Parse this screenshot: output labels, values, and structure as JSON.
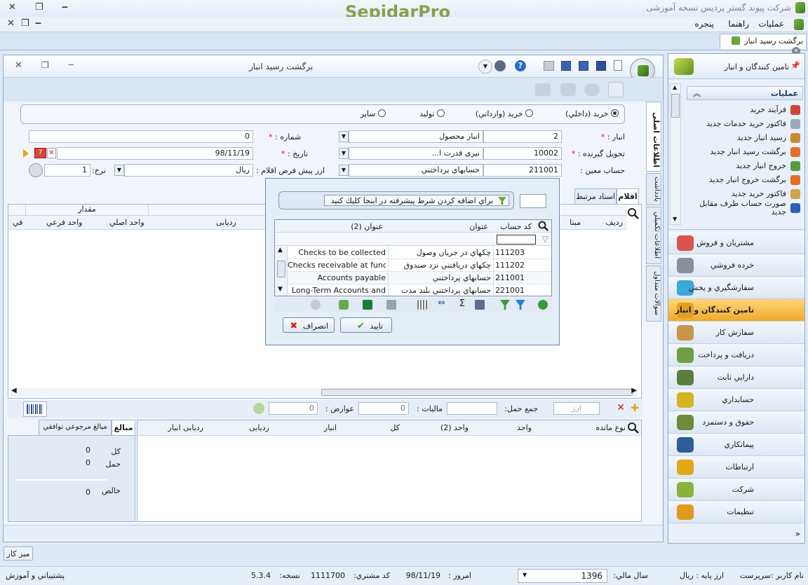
{
  "app": {
    "title": "شرکت پیوند گستر پردیس نسخه آموزشی",
    "logo": "SepidarPro",
    "menu": [
      "عملیات",
      "راهنما",
      "پنجره"
    ]
  },
  "doc_tab": {
    "label": "برگشت رسید انبار"
  },
  "doc": {
    "title": "برگشت رسید انبار",
    "side_tabs": [
      "اطلاعات اصلی",
      "يادداشت",
      "اطلاعات تكميلي",
      "سوالات متداول"
    ],
    "type_options": [
      "خريد (داخلي)",
      "خريد (وارداتي)",
      "توليد",
      "ساير"
    ],
    "type_selected": 0,
    "fields": {
      "anbar_label": "انبار :",
      "anbar_code": "2",
      "anbar_name": "انبار محصول",
      "tahvil_label": "تحويل گيرنده :",
      "tahvil_code": "10002",
      "tahvil_name": "نيري قدرت ا...",
      "hesab_label": "حساب معين :",
      "hesab_code": "211001",
      "hesab_name": "حسابهاي پرداختني",
      "shomare_label": "شماره :",
      "shomare_value": "0",
      "tarikh_label": "تاريخ :",
      "tarikh_value": "98/11/19",
      "arz_label": "ارز پيش فرض اقلام :",
      "arz_value": "ريال",
      "nerkh_label": "نرخ:",
      "nerkh_value": "1"
    },
    "item_tabs": [
      "اقلام",
      "اسناد مرتبط"
    ],
    "grid_headers": [
      "رديف",
      "مبنا",
      "ردیابی",
      "واحد اصلي",
      "واحد فرعي",
      "في"
    ],
    "grid_group_header": "مقدار",
    "footer": {
      "arz_placeholder": "ارز",
      "haml_label": "جمع حمل:",
      "maliat_label": "ماليات :",
      "maliat_value": "0",
      "avarez_label": "عوارض :",
      "avarez_value": "0"
    },
    "lower_headers": [
      "نوع مانده",
      "واحد",
      "واحد (2)",
      "كل",
      "انبار",
      "ردیابی",
      "ردیابی انبار"
    ],
    "lower_tabs": [
      "مبالغ",
      "مبالغ مرجوعي توافقي"
    ],
    "summary": [
      {
        "label": "كل",
        "value": "0"
      },
      {
        "label": "حمل",
        "value": "0"
      },
      {
        "label": "خالص",
        "value": "0"
      }
    ]
  },
  "lookup_dialog": {
    "filter_hint": "براي اضافه كردن شرط پيشرفته در اينجا كليك كنيد",
    "columns": [
      "كد حساب",
      "عنوان",
      "عنوان (2)"
    ],
    "rows": [
      {
        "code": "111203",
        "title": "چكهاي در جريان وصول",
        "title2": "Checks to be collected"
      },
      {
        "code": "111202",
        "title": "چكهاي دريافتني نزد صندوق",
        "title2": "Checks receivable at fund"
      },
      {
        "code": "211001",
        "title": "حسابهاي پرداختني",
        "title2": "Accounts payable"
      },
      {
        "code": "221001",
        "title": "حسابهاي پرداختني بلند مدت",
        "title2": "Long-Term Accounts and"
      }
    ],
    "ok_label": "تاييد",
    "cancel_label": "انصراف"
  },
  "nav": {
    "header": "تامين كنندگان و انبار",
    "section_title": "عمليات",
    "operations": [
      "فرآيند خريد",
      "فاكتور خريد خدمات جديد",
      "رسيد انبار جديد",
      "برگشت رسيد انبار جديد",
      "خروج انبار جديد",
      "برگشت خروج انبار جديد",
      "فاكتور خريد جديد",
      "صورت حساب طرف مقابل جديد"
    ],
    "modules": [
      {
        "label": "مشتريان و فروش",
        "color": "#d9534f"
      },
      {
        "label": "خرده فروشي",
        "color": "#8a8f99"
      },
      {
        "label": "سفارشگيري و پخش",
        "color": "#3aa9d8"
      },
      {
        "label": "تامين كنندگان و انبار",
        "color": "#e6a020"
      },
      {
        "label": "سفارش كار",
        "color": "#c8964a"
      },
      {
        "label": "دريافت و پرداخت",
        "color": "#6f9e47"
      },
      {
        "label": "دارايي ثابت",
        "color": "#5a7f3c"
      },
      {
        "label": "حسابداري",
        "color": "#d2b51f"
      },
      {
        "label": "حقوق و دستمزد",
        "color": "#6e8a3a"
      },
      {
        "label": "پيمانكاري",
        "color": "#2f5b9a"
      },
      {
        "label": "ارتباطات",
        "color": "#e4a817"
      },
      {
        "label": "شركت",
        "color": "#8bb33c"
      },
      {
        "label": "تنظيمات",
        "color": "#e09a1c"
      }
    ],
    "active_module": 3
  },
  "taskbar": {
    "desk_label": "ميز كار"
  },
  "status": {
    "user": "نام كاربر :سرپرست",
    "base_currency": "ارز پايه : ريال",
    "fiscal_label": "سال مالي:",
    "fiscal_value": "1396",
    "today_label": "امروز :",
    "today_value": "98/11/19",
    "customer_label": "كد مشتري:",
    "customer_value": "1111700",
    "version_label": "نسخه:",
    "version_value": "5.3.4",
    "support": "پشتيباني و آموزش"
  },
  "colors": {
    "accent": "#f0b429",
    "frame": "#8ea9cc",
    "logo_green": "#8aa04a"
  }
}
